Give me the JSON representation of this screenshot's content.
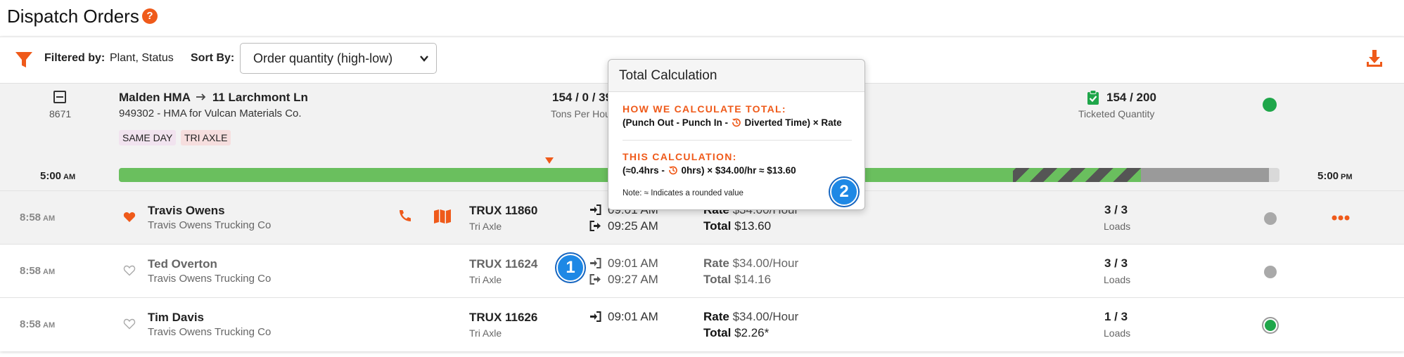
{
  "page": {
    "title": "Dispatch Orders",
    "help_glyph": "?"
  },
  "filters": {
    "filtered_by_label": "Filtered by:",
    "filtered_by_value": "Plant, Status",
    "sort_label": "Sort By:",
    "sort_value": "Order quantity (high-low)"
  },
  "order": {
    "id": "8671",
    "origin": "Malden HMA",
    "destination": "11 Larchmont Ln",
    "description": "949302 - HMA for Vulcan Materials Co.",
    "tags": [
      "SAME DAY",
      "TRI AXLE"
    ],
    "tons_value": "154 / 0 / 39",
    "tons_label": "Tons Per Hou",
    "ticketed_value": "154 / 200",
    "ticketed_label": "Ticketed Quantity",
    "status_color": "#1fa64a"
  },
  "timeline": {
    "start_time": "5:00",
    "start_ampm": "AM",
    "end_time": "5:00",
    "end_ampm": "PM",
    "progress_fraction": 0.77,
    "striped_fraction": 0.11,
    "remaining_fraction": 0.11
  },
  "rows": [
    {
      "time": "8:58",
      "ampm": "AM",
      "favorite": true,
      "driver": "Travis Owens",
      "company": "Travis Owens Trucking Co",
      "truck": "TRUX 11860",
      "truck_type": "Tri Axle",
      "punch_in": "09:01 AM",
      "punch_out": "09:25 AM",
      "rate_label": "Rate",
      "rate": "$34.00/Hour",
      "total_label": "Total",
      "total": "$13.60",
      "loads": "3 / 3",
      "loads_label": "Loads"
    },
    {
      "time": "8:58",
      "ampm": "AM",
      "favorite": false,
      "driver": "Ted Overton",
      "company": "Travis Owens Trucking Co",
      "truck": "TRUX 11624",
      "truck_type": "Tri Axle",
      "punch_in": "09:01 AM",
      "punch_out": "09:27 AM",
      "rate_label": "Rate",
      "rate": "$34.00/Hour",
      "total_label": "Total",
      "total": "$14.16",
      "loads": "3 / 3",
      "loads_label": "Loads"
    },
    {
      "time": "8:58",
      "ampm": "AM",
      "favorite": false,
      "driver": "Tim Davis",
      "company": "Travis Owens Trucking Co",
      "truck": "TRUX 11626",
      "truck_type": "Tri Axle",
      "punch_in": "09:01 AM",
      "punch_out": "",
      "rate_label": "Rate",
      "rate": "$34.00/Hour",
      "total_label": "Total",
      "total": "$2.26*",
      "loads": "1 / 3",
      "loads_label": "Loads"
    }
  ],
  "popover": {
    "title": "Total Calculation",
    "how_heading": "HOW WE CALCULATE TOTAL:",
    "formula_a": "(Punch Out - Punch In - ",
    "formula_b": " Diverted Time) × Rate",
    "this_heading": "THIS CALCULATION:",
    "calc_a": "(≈0.4hrs - ",
    "calc_b": " 0hrs) × $34.00/hr ≈ $13.60",
    "note": "Note: ≈ Indicates a rounded value"
  },
  "badges": {
    "one": "1",
    "two": "2"
  },
  "colors": {
    "accent": "#ef5a1a",
    "green": "#1fa64a",
    "badge_blue": "#1e88e5"
  },
  "icons": [
    "help-icon",
    "filter-icon",
    "download-icon",
    "minus-square-icon",
    "arrow-right-icon",
    "clipboard-check-icon",
    "heart-icon",
    "phone-icon",
    "map-icon",
    "punch-in-icon",
    "punch-out-icon",
    "history-icon",
    "more-icon"
  ]
}
